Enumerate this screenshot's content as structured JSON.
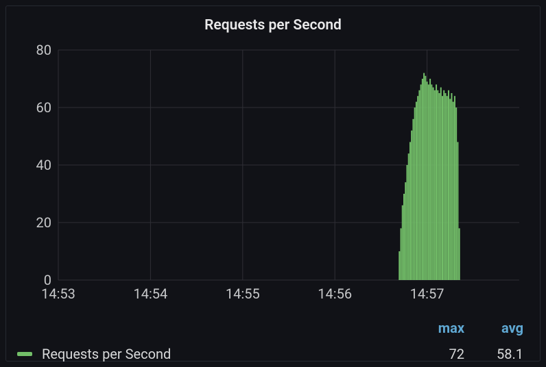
{
  "chart_data": {
    "type": "bar",
    "title": "Requests per Second",
    "xlabel": "",
    "ylabel": "",
    "ylim": [
      0,
      80
    ],
    "yticks": [
      0,
      20,
      40,
      60,
      80
    ],
    "x_tick_labels": [
      "14:53",
      "14:54",
      "14:55",
      "14:56",
      "14:57"
    ],
    "x_range_seconds": [
      0,
      300
    ],
    "series": [
      {
        "name": "Requests per Second",
        "color": "#73bf69",
        "max": 72,
        "avg": 58.1,
        "points": [
          {
            "t": 222,
            "v": 10
          },
          {
            "t": 223,
            "v": 18
          },
          {
            "t": 224,
            "v": 26
          },
          {
            "t": 225,
            "v": 30
          },
          {
            "t": 226,
            "v": 34
          },
          {
            "t": 227,
            "v": 40
          },
          {
            "t": 228,
            "v": 44
          },
          {
            "t": 229,
            "v": 48
          },
          {
            "t": 230,
            "v": 52
          },
          {
            "t": 231,
            "v": 56
          },
          {
            "t": 232,
            "v": 60
          },
          {
            "t": 233,
            "v": 62
          },
          {
            "t": 234,
            "v": 64
          },
          {
            "t": 235,
            "v": 66
          },
          {
            "t": 236,
            "v": 68
          },
          {
            "t": 237,
            "v": 70
          },
          {
            "t": 238,
            "v": 72
          },
          {
            "t": 239,
            "v": 71
          },
          {
            "t": 240,
            "v": 69
          },
          {
            "t": 241,
            "v": 68
          },
          {
            "t": 242,
            "v": 70
          },
          {
            "t": 243,
            "v": 68
          },
          {
            "t": 244,
            "v": 67
          },
          {
            "t": 245,
            "v": 66
          },
          {
            "t": 246,
            "v": 68
          },
          {
            "t": 247,
            "v": 66
          },
          {
            "t": 248,
            "v": 65
          },
          {
            "t": 249,
            "v": 67
          },
          {
            "t": 250,
            "v": 64
          },
          {
            "t": 251,
            "v": 66
          },
          {
            "t": 252,
            "v": 65
          },
          {
            "t": 253,
            "v": 64
          },
          {
            "t": 254,
            "v": 66
          },
          {
            "t": 255,
            "v": 63
          },
          {
            "t": 256,
            "v": 65
          },
          {
            "t": 257,
            "v": 62
          },
          {
            "t": 258,
            "v": 64
          },
          {
            "t": 259,
            "v": 60
          },
          {
            "t": 260,
            "v": 48
          },
          {
            "t": 261,
            "v": 18
          }
        ]
      }
    ]
  },
  "legend": {
    "columns": [
      "max",
      "avg"
    ],
    "rows": [
      {
        "label": "Requests per Second",
        "max": "72",
        "avg": "58.1"
      }
    ]
  }
}
